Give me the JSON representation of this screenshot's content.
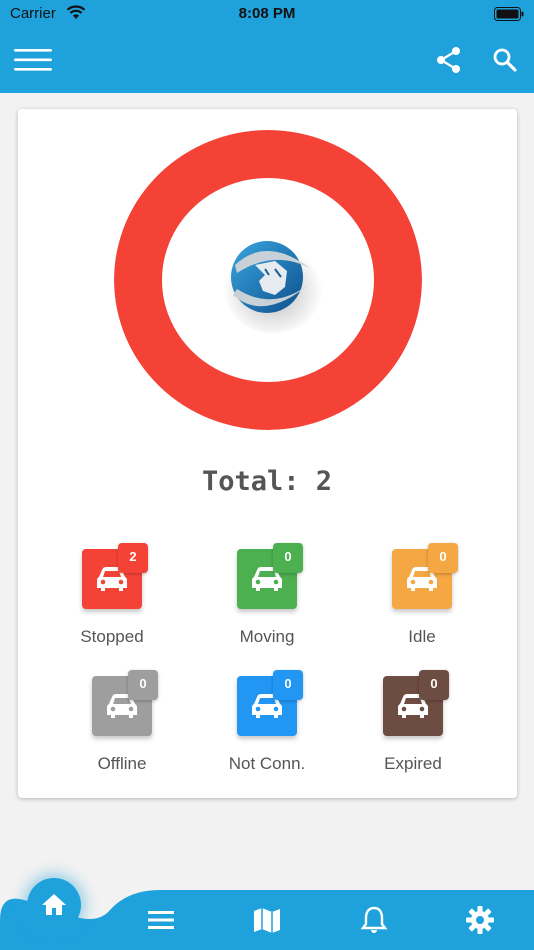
{
  "status_bar": {
    "carrier": "Carrier",
    "time": "8:08 PM"
  },
  "app_bar": {
    "icons": [
      "menu-icon",
      "share-icon",
      "search-icon"
    ]
  },
  "summary": {
    "total_text": "Total: 2",
    "ring_color": "#f44336"
  },
  "categories": [
    {
      "label": "Stopped",
      "count": "2",
      "color": "#f44336",
      "badge_color": "#f44336"
    },
    {
      "label": "Moving",
      "count": "0",
      "color": "#4caf50",
      "badge_color": "#4caf50"
    },
    {
      "label": "Idle",
      "count": "0",
      "color": "#f4a742",
      "badge_color": "#f4a742"
    },
    {
      "label": "Offline",
      "count": "0",
      "color": "#9e9e9e",
      "badge_color": "#9e9e9e"
    },
    {
      "label": "Not Conn.",
      "count": "0",
      "color": "#2196f3",
      "badge_color": "#2196f3"
    },
    {
      "label": "Expired",
      "count": "0",
      "color": "#6d4c41",
      "badge_color": "#6d4c41"
    }
  ],
  "bottom_nav": {
    "items": [
      "home-icon",
      "list-icon",
      "map-icon",
      "bell-icon",
      "gear-icon"
    ],
    "accent": "#1fa2dc"
  }
}
